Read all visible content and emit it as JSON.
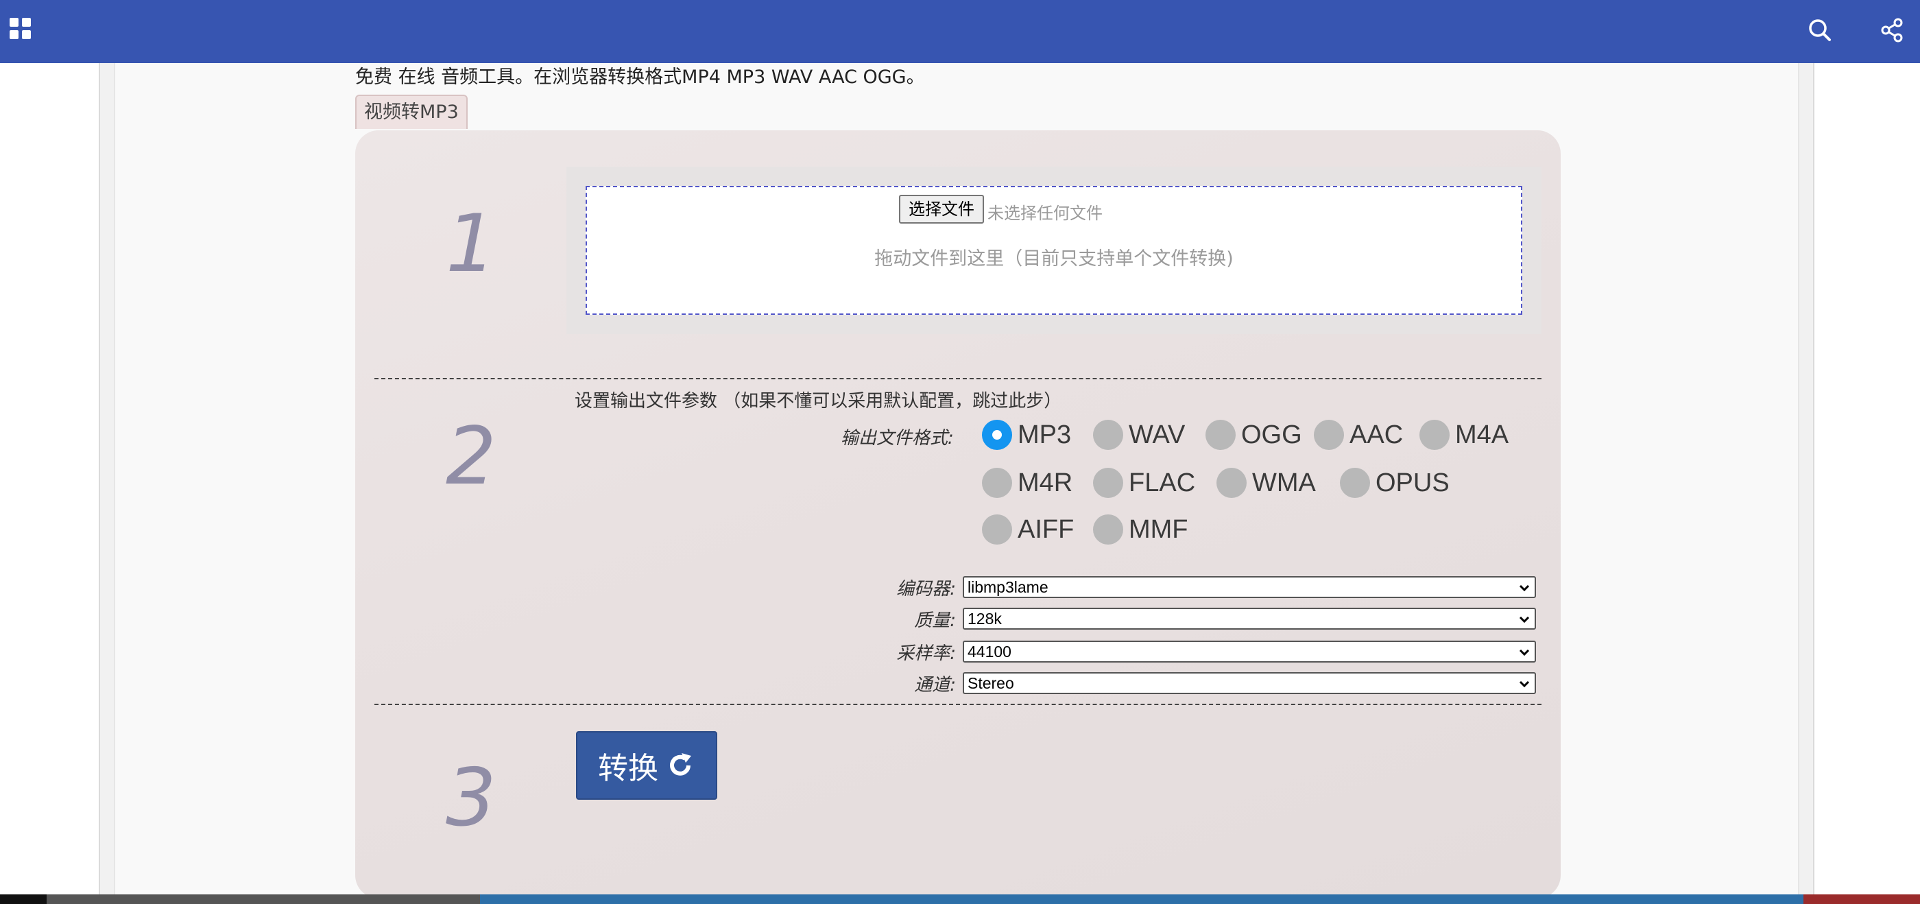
{
  "header": {
    "apps_icon": "apps-grid-icon",
    "search_icon": "search-icon",
    "share_icon": "share-icon",
    "bar_color": "#3755b1"
  },
  "intro_text": "免费 在线 音频工具。在浏览器转换格式MP4 MP3 WAV AAC OGG。",
  "tab_label": "视频转MP3",
  "step1": {
    "number": "1",
    "choose_file_button": "选择文件",
    "no_file_text": "未选择任何文件",
    "drop_hint": "拖动文件到这里（目前只支持单个文件转换)"
  },
  "step2": {
    "number": "2",
    "title": "设置输出文件参数 （如果不懂可以采用默认配置，跳过此步）",
    "format_label": "输出文件格式:",
    "formats": [
      {
        "label": "MP3",
        "selected": true
      },
      {
        "label": "WAV",
        "selected": false
      },
      {
        "label": "OGG",
        "selected": false
      },
      {
        "label": "AAC",
        "selected": false
      },
      {
        "label": "M4A",
        "selected": false
      },
      {
        "label": "M4R",
        "selected": false
      },
      {
        "label": "FLAC",
        "selected": false
      },
      {
        "label": "WMA",
        "selected": false
      },
      {
        "label": "OPUS",
        "selected": false
      },
      {
        "label": "AIFF",
        "selected": false
      },
      {
        "label": "MMF",
        "selected": false
      }
    ],
    "params": [
      {
        "label": "编码器:",
        "value": "libmp3lame"
      },
      {
        "label": "质量:",
        "value": "128k"
      },
      {
        "label": "采样率:",
        "value": "44100"
      },
      {
        "label": "通道:",
        "value": "Stereo"
      }
    ]
  },
  "step3": {
    "number": "3",
    "convert_button": "转换",
    "convert_icon": "refresh-icon"
  }
}
